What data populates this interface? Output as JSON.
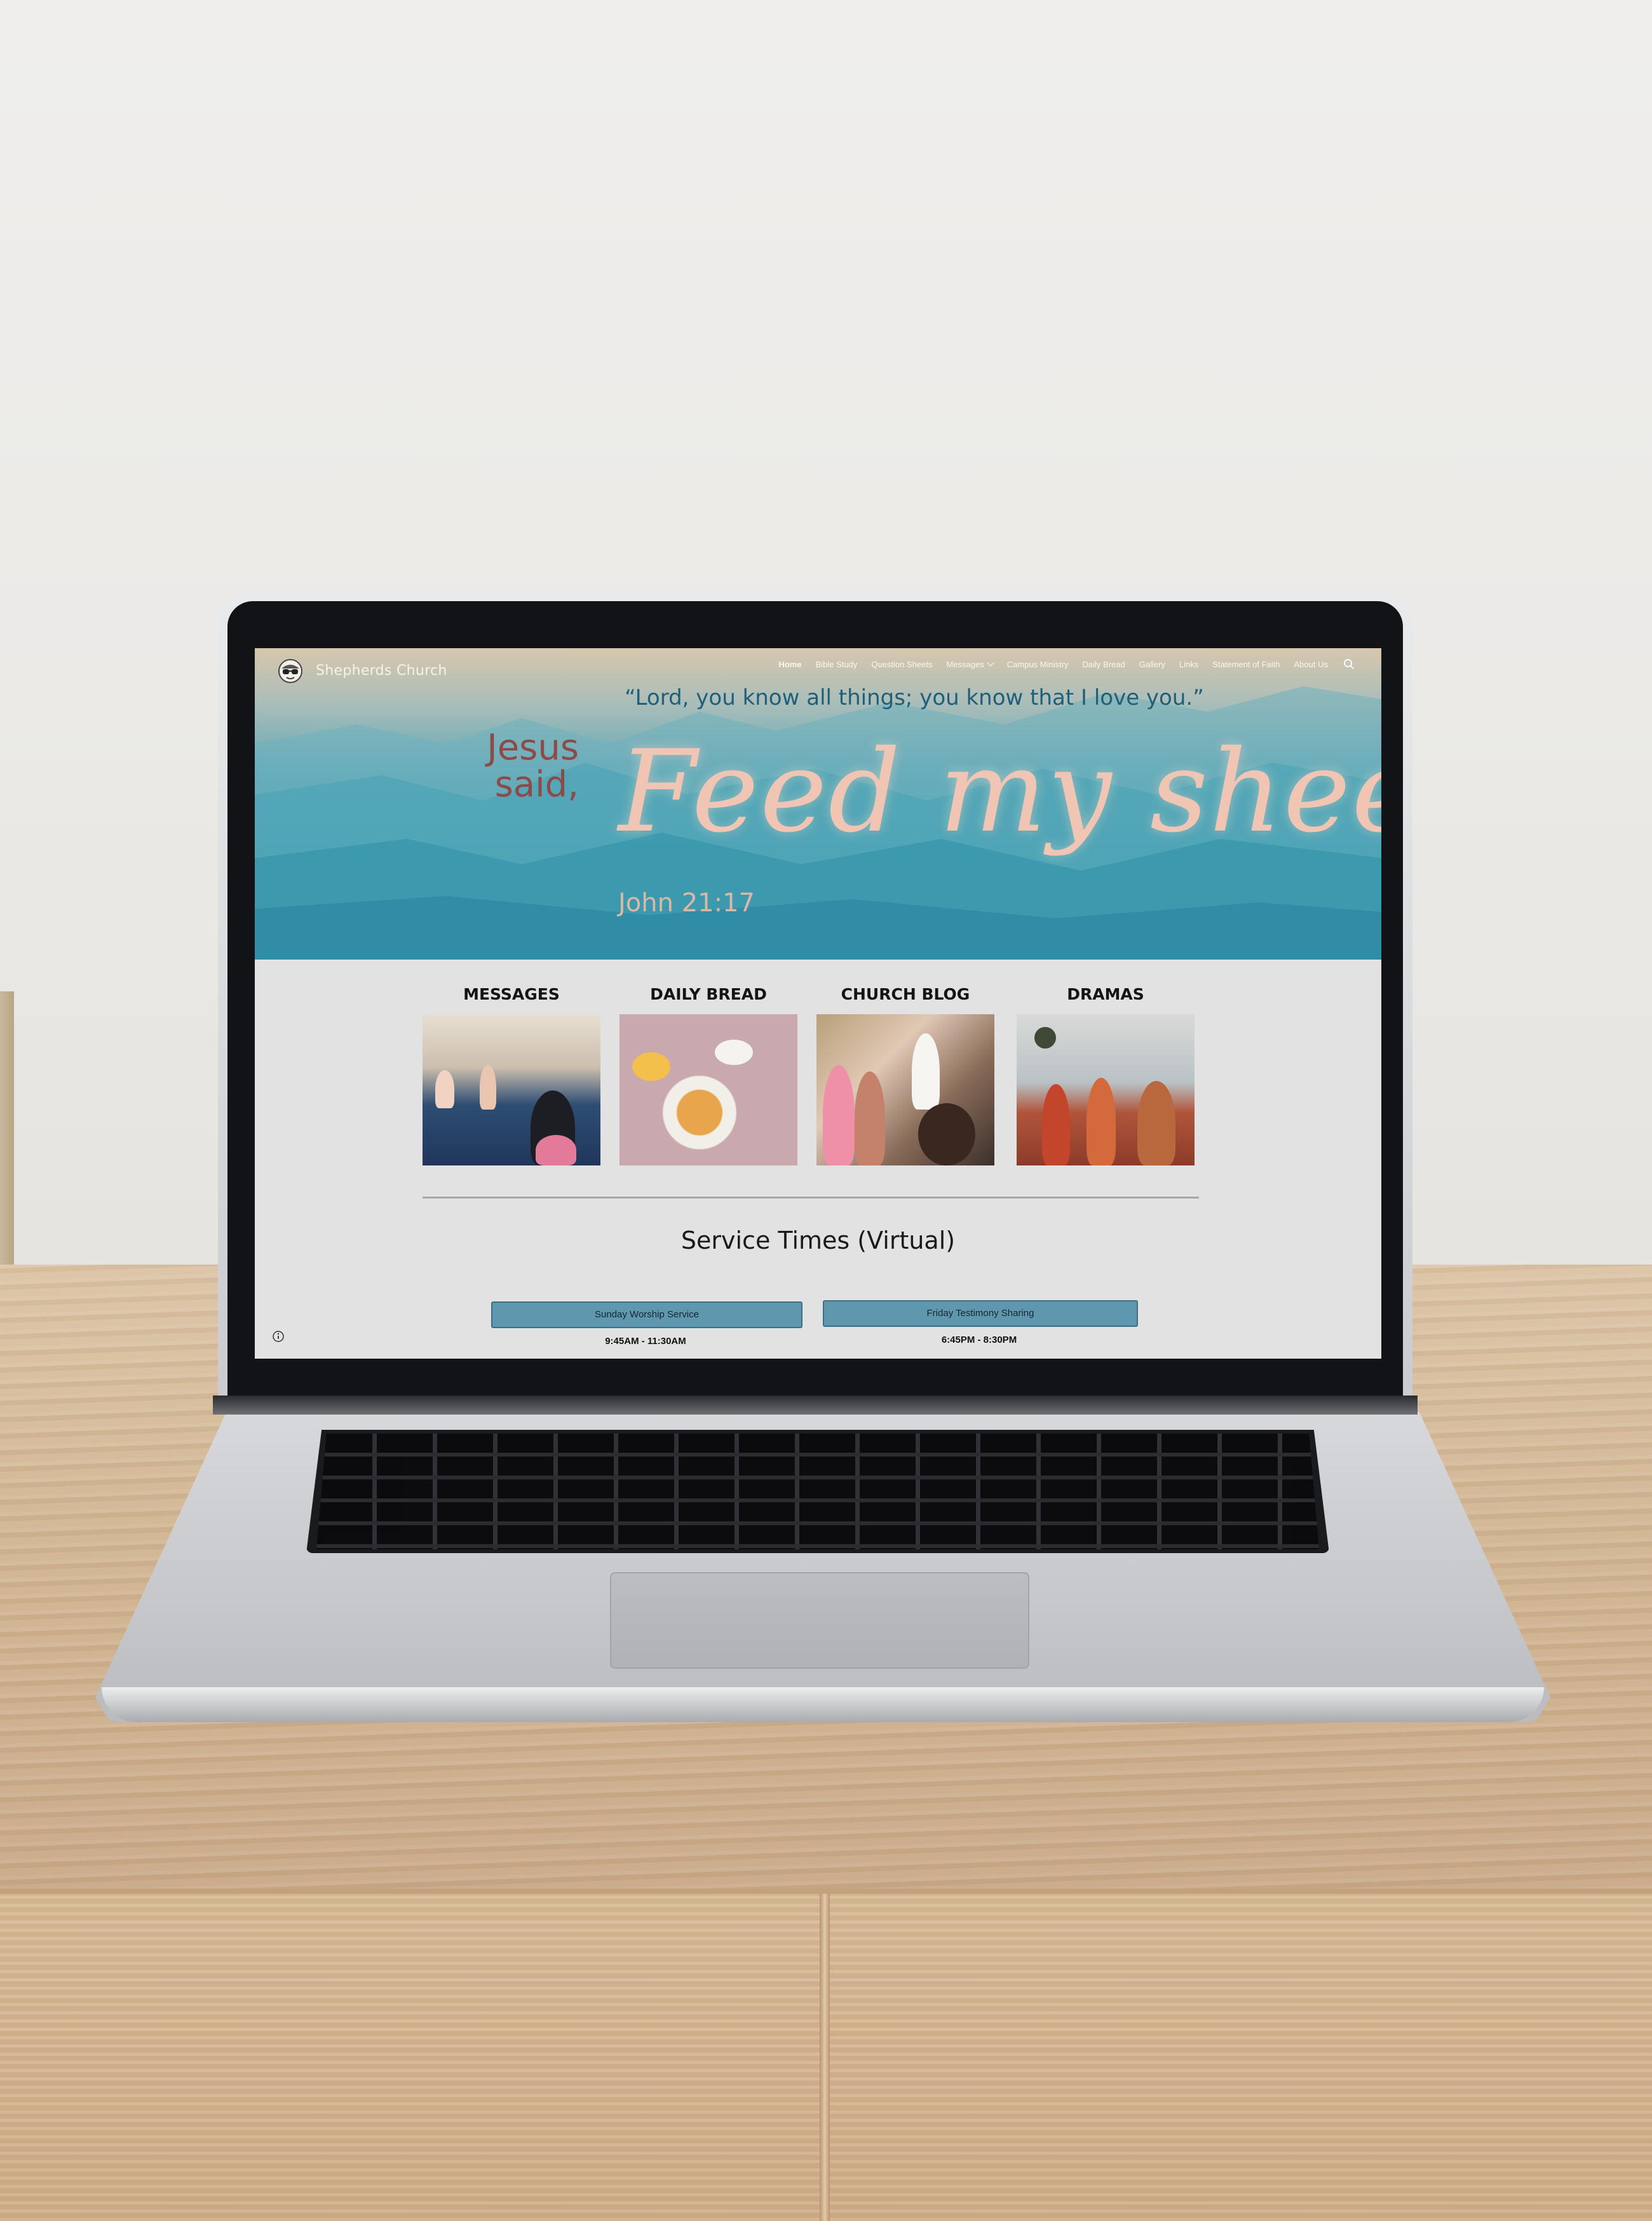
{
  "site": {
    "title": "Shepherds Church"
  },
  "nav": {
    "items": [
      {
        "label": "Home",
        "active": true
      },
      {
        "label": "Bible Study"
      },
      {
        "label": "Question Sheets"
      },
      {
        "label": "Messages",
        "has_dropdown": true
      },
      {
        "label": "Campus Ministry"
      },
      {
        "label": "Daily Bread"
      },
      {
        "label": "Gallery"
      },
      {
        "label": "Links"
      },
      {
        "label": "Statement of Faith"
      },
      {
        "label": "About Us"
      }
    ],
    "search_icon": "search-icon"
  },
  "hero": {
    "quote": "“Lord, you know all things; you know that I love you.”",
    "jesus_line1": "Jesus",
    "jesus_line2": "said,",
    "headline": "Feed my sheep.",
    "verse": "John 21:17"
  },
  "cards": [
    {
      "title": "MESSAGES"
    },
    {
      "title": "DAILY BREAD"
    },
    {
      "title": "CHURCH BLOG"
    },
    {
      "title": "DRAMAS"
    }
  ],
  "service": {
    "title": "Service Times (Virtual)",
    "items": [
      {
        "label": "Sunday Worship Service",
        "time": "9:45AM - 11:30AM"
      },
      {
        "label": "Friday Testimony Sharing",
        "time": "6:45PM - 8:30PM"
      }
    ]
  },
  "colors": {
    "accent_button": "#5f98ae",
    "hero_teal": "#3c9db0",
    "jesus_said": "#8e4a48",
    "headline": "#f0c5b3",
    "quote": "#1f5f79"
  }
}
